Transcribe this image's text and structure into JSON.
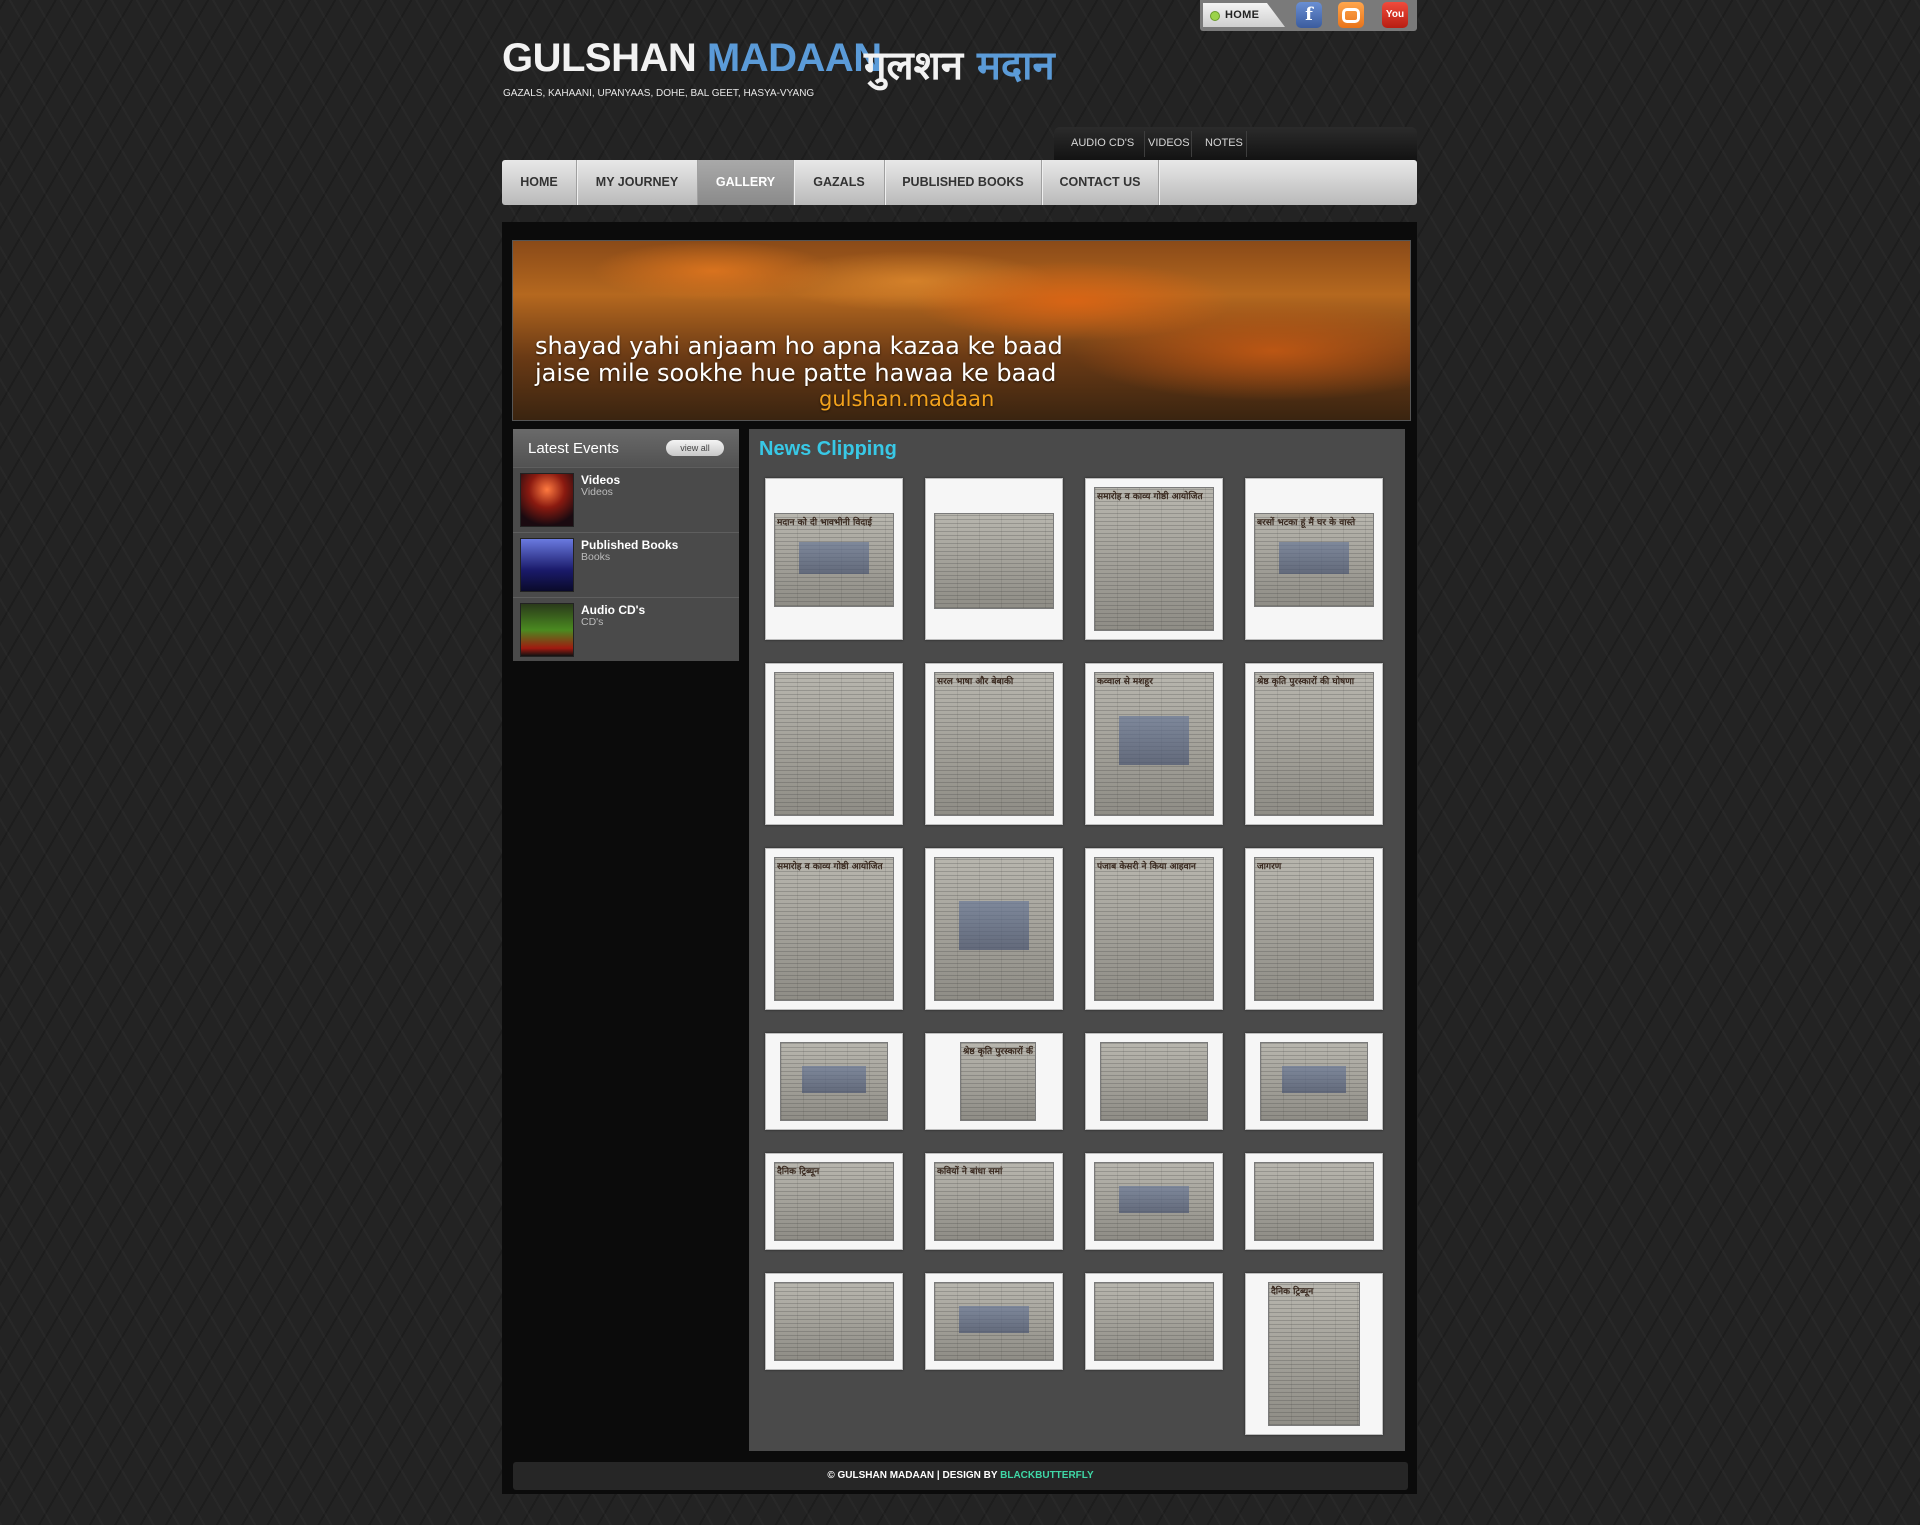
{
  "topbar": {
    "home_label": "HOME",
    "social": [
      {
        "icon": "facebook-icon",
        "glyph": "f"
      },
      {
        "icon": "blogger-icon",
        "glyph": ""
      },
      {
        "icon": "youtube-icon",
        "glyph": "You"
      }
    ]
  },
  "brand": {
    "name_first": "GULSHAN",
    "name_last": "MADAAN",
    "hindi_first": "गुलशन",
    "hindi_last": "मदान",
    "tagline": "GAZALS, KAHAANI, UPANYAAS, DOHE, BAL GEET, HASYA-VYANG",
    "accent_color": "#5b9bd8"
  },
  "subnav": [
    "AUDIO CD'S",
    "VIDEOS",
    "NOTES"
  ],
  "mainnav": {
    "items": [
      "HOME",
      "MY JOURNEY",
      "GALLERY",
      "GAZALS",
      "PUBLISHED BOOKS",
      "CONTACT US"
    ],
    "active": "GALLERY"
  },
  "banner": {
    "line1": "shayad yahi anjaam ho apna kazaa ke baad",
    "line2": "jaise mile sookhe hue patte hawaa ke baad",
    "signature": "gulshan.madaan"
  },
  "sidebar": {
    "title": "Latest Events",
    "view_all": "view all",
    "events": [
      {
        "title": "Videos",
        "subtitle": "Videos"
      },
      {
        "title": "Published Books",
        "subtitle": "Books"
      },
      {
        "title": "Audio CD's",
        "subtitle": "CD's"
      }
    ]
  },
  "gallery": {
    "title": "News Clipping",
    "title_color": "#38c8e6",
    "rows": [
      [
        "मदान को दी भावभीनी विदाई",
        "",
        "समारोह व काव्य गोष्ठी आयोजित",
        "बरसों भटका हूं मैं घर के वास्ते"
      ],
      [
        "",
        "सरल भाषा और बेबाकी",
        "कव्वाल से मशहूर",
        "श्रेष्ठ कृति पुरस्कारों की घोषणा"
      ],
      [
        "समारोह व काव्य गोष्ठी आयोजित",
        "",
        "पंजाब केसरी ने किया आहवान",
        "जागरण"
      ],
      [
        "",
        "श्रेष्ठ कृति पुरस्कारों की घोषणा",
        "",
        ""
      ],
      [
        "दैनिक ट्रिब्यून",
        "कवियों ने बांधा समां",
        "",
        ""
      ],
      [
        "",
        "",
        "",
        "दैनिक ट्रिब्यून"
      ]
    ]
  },
  "footer": {
    "text": "© GULSHAN MADAAN | DESIGN BY",
    "designer": "BLACKBUTTERFLY",
    "designer_color": "#3fd7a6"
  }
}
